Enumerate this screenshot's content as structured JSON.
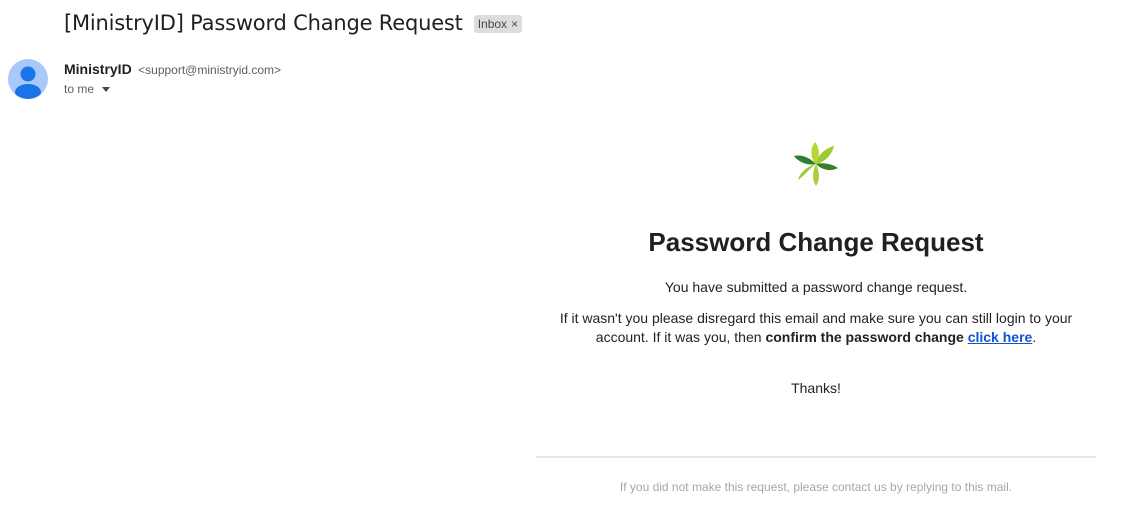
{
  "email": {
    "subject": "[MinistryID] Password Change Request",
    "label_chip": "Inbox",
    "label_remove": "×",
    "sender_name": "MinistryID",
    "sender_email": "<support@ministryid.com>",
    "recipient": "to me"
  },
  "body": {
    "logo_icon": "pinwheel-leaf-logo",
    "title": "Password Change Request",
    "line1": "You have submitted a password change request.",
    "line2_prefix": "If it wasn't you please disregard this email and make sure you can still login to your account. If it was you, then ",
    "line2_bold": "confirm the password change",
    "line2_space": " ",
    "link_text": "click here",
    "line2_suffix": ".",
    "thanks": "Thanks!",
    "footer": "If you did not make this request, please contact us by replying to this mail."
  },
  "colors": {
    "avatar_bg": "#a8c7fa",
    "avatar_fg": "#1a73e8",
    "link": "#1155cc",
    "logo_light_green": "#9ccc33",
    "logo_dark_green": "#2e7d32"
  }
}
